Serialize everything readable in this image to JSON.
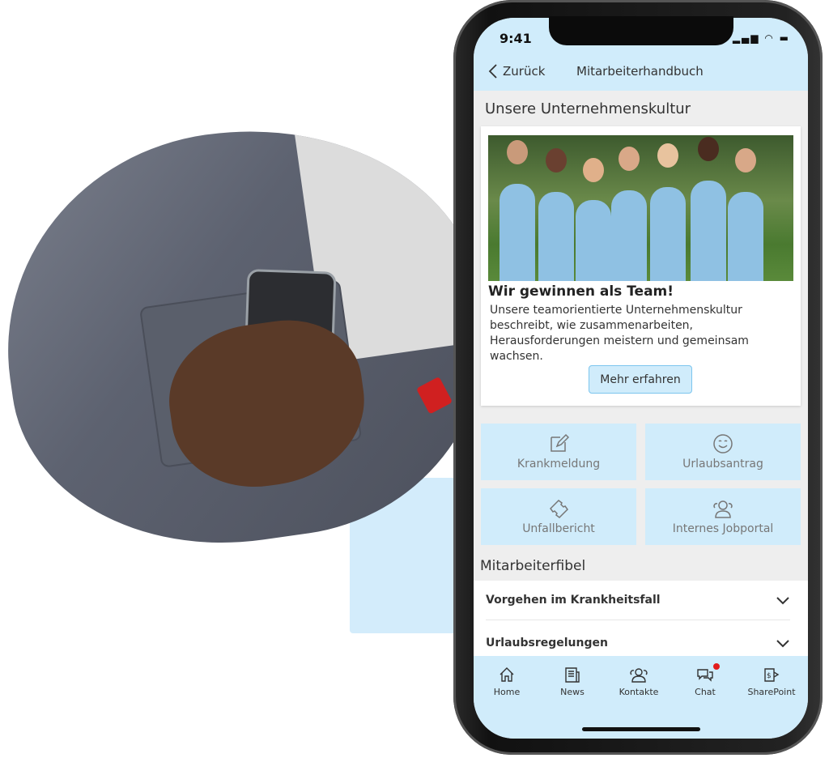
{
  "status": {
    "time": "9:41",
    "icons": [
      "signal-icon",
      "wifi-icon",
      "battery-icon"
    ]
  },
  "nav": {
    "back_label": "Zurück",
    "title": "Mitarbeiterhandbuch"
  },
  "culture": {
    "heading": "Unsere Unternehmenskultur",
    "card_title": "Wir gewinnen als Team!",
    "card_text": "Unsere teamorientierte Unternehmenskultur beschreibt, wie zusammenarbeiten, Herausforderungen meistern und gemeinsam wachsen.",
    "button": "Mehr erfahren"
  },
  "tiles": [
    {
      "label": "Krankmeldung",
      "icon": "edit-icon"
    },
    {
      "label": "Urlaubsantrag",
      "icon": "smiley-icon"
    },
    {
      "label": "Unfallbericht",
      "icon": "bandage-icon"
    },
    {
      "label": "Internes Jobportal",
      "icon": "people-icon"
    }
  ],
  "fibel": {
    "heading": "Mitarbeiterfibel",
    "items": [
      {
        "label": "Vorgehen im Krankheitsfall"
      },
      {
        "label": "Urlaubsregelungen"
      }
    ]
  },
  "tabbar": [
    {
      "label": "Home",
      "icon": "home-icon"
    },
    {
      "label": "News",
      "icon": "news-icon"
    },
    {
      "label": "Kontakte",
      "icon": "contacts-icon"
    },
    {
      "label": "Chat",
      "icon": "chat-icon",
      "notification": true
    },
    {
      "label": "SharePoint",
      "icon": "sharepoint-icon"
    }
  ],
  "colors": {
    "accent": "#d0ecfb",
    "button_border": "#7cc5ee",
    "notification": "#e21c1c"
  }
}
